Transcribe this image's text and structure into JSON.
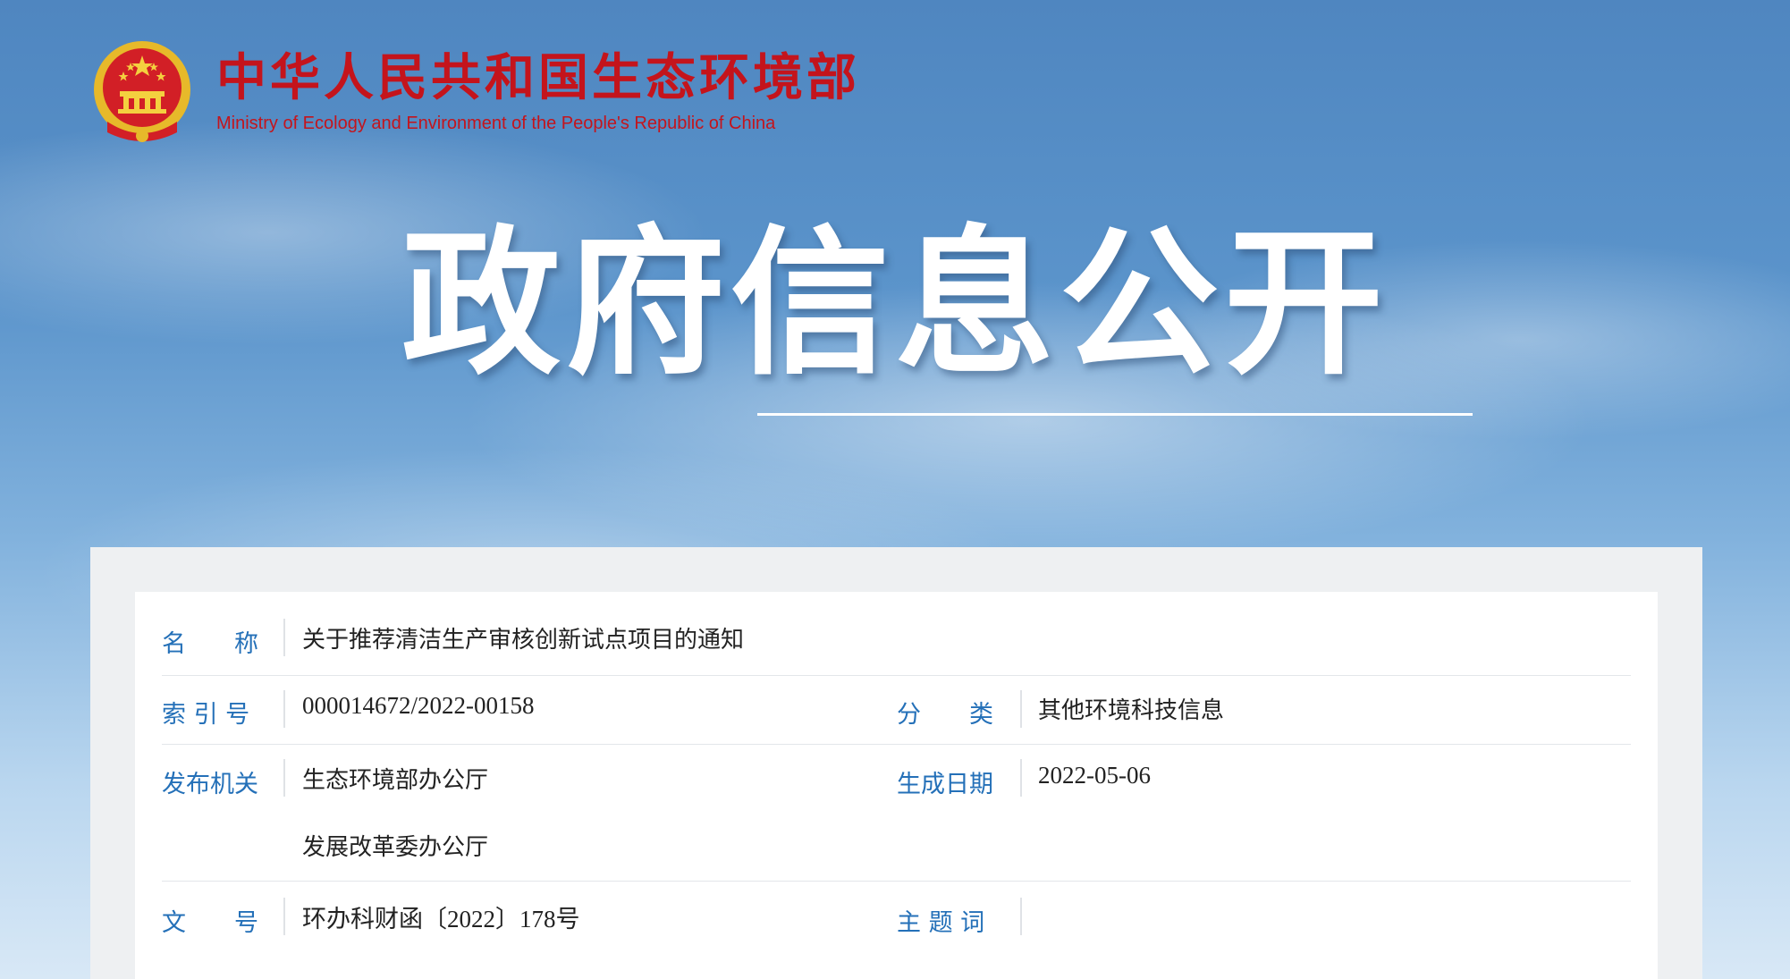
{
  "header": {
    "title_cn": "中华人民共和国生态环境部",
    "title_en": "Ministry of Ecology and Environment of the People's Republic of China"
  },
  "hero": {
    "title": "政府信息公开"
  },
  "info": {
    "name_label": "名　　称",
    "name_value": "关于推荐清洁生产审核创新试点项目的通知",
    "index_label": "索 引 号",
    "index_value": "000014672/2022-00158",
    "category_label": "分　　类",
    "category_value": "其他环境科技信息",
    "issuer_label": "发布机关",
    "issuer_values": [
      "生态环境部办公厅",
      "发展改革委办公厅"
    ],
    "date_label": "生成日期",
    "date_value": "2022-05-06",
    "docno_label": "文　　号",
    "docno_value": "环办科财函〔2022〕178号",
    "keywords_label": "主 题 词",
    "keywords_value": ""
  },
  "colors": {
    "brand_red": "#c4141c",
    "label_blue": "#2470b8"
  }
}
